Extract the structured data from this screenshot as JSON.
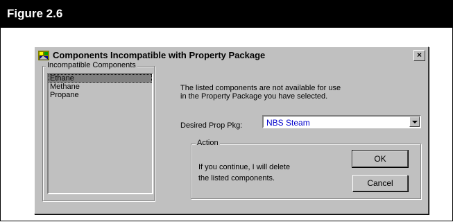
{
  "figure": {
    "heading": "Figure 2.6"
  },
  "dialog": {
    "title": "Components Incompatible with Property Package",
    "close_label": "×",
    "incompatible_group": {
      "legend": "Incompatible Components",
      "items": [
        "Ethane",
        "Methane",
        "Propane"
      ],
      "selected_index": 0
    },
    "info_text_line1": "The listed components are not available for use",
    "info_text_line2": "in the Property Package you have selected.",
    "prop_pkg": {
      "label": "Desired Prop Pkg:",
      "value": "NBS Steam"
    },
    "action_group": {
      "legend": "Action",
      "text_line1": "If you continue, I will delete",
      "text_line2": "the listed components.",
      "ok_label": "OK",
      "cancel_label": "Cancel"
    }
  }
}
